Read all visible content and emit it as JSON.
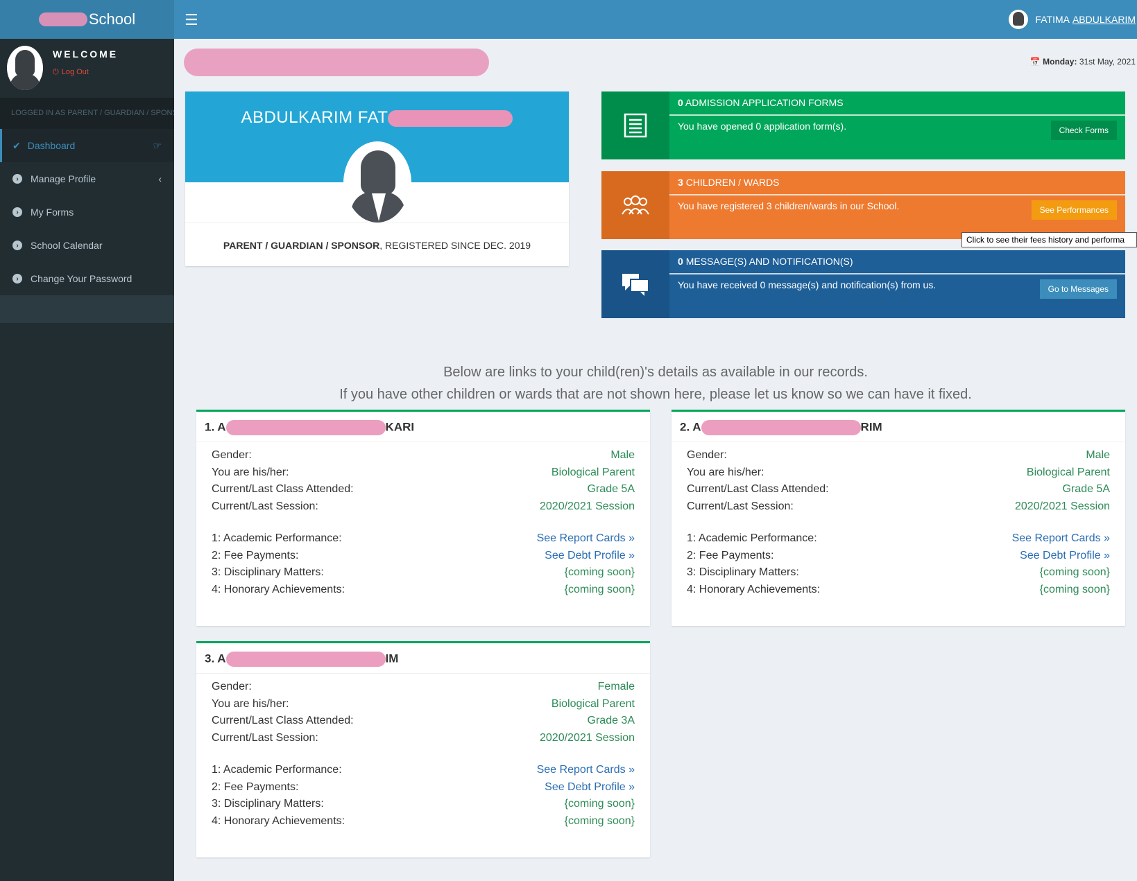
{
  "header": {
    "logo_text": "School",
    "user_first": "FATIMA",
    "user_last": "ABDULKARIM"
  },
  "sidebar": {
    "welcome": "WELCOME",
    "logout": "Log Out",
    "logged_in_as": "LOGGED IN AS PARENT / GUARDIAN / SPONSOR",
    "items": [
      {
        "label": "Dashboard"
      },
      {
        "label": "Manage Profile"
      },
      {
        "label": "My Forms"
      },
      {
        "label": "School Calendar"
      },
      {
        "label": "Change Your Password"
      }
    ]
  },
  "date": {
    "day": "Monday:",
    "value": "31st May, 2021"
  },
  "profile": {
    "name": "ABDULKARIM FAT",
    "role": "PARENT / GUARDIAN / SPONSOR",
    "since": ", REGISTERED SINCE DEC. 2019"
  },
  "boxes": {
    "forms": {
      "count": "0",
      "title": "ADMISSION APPLICATION FORMS",
      "text": "You have opened 0 application form(s).",
      "button": "Check Forms"
    },
    "children": {
      "count": "3",
      "title": "CHILDREN / WARDS",
      "text": "You have registered 3 children/wards in our School.",
      "button": "See Performances"
    },
    "messages": {
      "count": "0",
      "title": "MESSAGE(S) AND NOTIFICATION(S)",
      "text": "You have received 0 message(s) and notification(s) from us.",
      "button": "Go to Messages"
    }
  },
  "tooltip": "Click to see their fees history and performa",
  "intro": {
    "line1": "Below are links to your child(ren)'s details as available in our records.",
    "line2": "If you have other children or wards that are not shown here, please let us know so we can have it fixed."
  },
  "labels": {
    "gender": "Gender:",
    "relation": "You are his/her:",
    "class": "Current/Last Class Attended:",
    "session": "Current/Last Session:",
    "academic": "1: Academic Performance:",
    "fees": "2: Fee Payments:",
    "discipline": "3: Disciplinary Matters:",
    "honors": "4: Honorary Achievements:"
  },
  "children": [
    {
      "num": "1. A",
      "suffix": "KARI",
      "gender": "Male",
      "relation": "Biological Parent",
      "class": "Grade 5A",
      "session": "2020/2021 Session",
      "academic": "See Report Cards »",
      "fees": "See Debt Profile »",
      "discipline": "{coming soon}",
      "honors": "{coming soon}"
    },
    {
      "num": "2. A",
      "suffix": "RIM",
      "gender": "Male",
      "relation": "Biological Parent",
      "class": "Grade 5A",
      "session": "2020/2021 Session",
      "academic": "See Report Cards »",
      "fees": "See Debt Profile »",
      "discipline": "{coming soon}",
      "honors": "{coming soon}"
    },
    {
      "num": "3. A",
      "suffix": "IM",
      "gender": "Female",
      "relation": "Biological Parent",
      "class": "Grade 3A",
      "session": "2020/2021 Session",
      "academic": "See Report Cards »",
      "fees": "See Debt Profile »",
      "discipline": "{coming soon}",
      "honors": "{coming soon}"
    }
  ]
}
